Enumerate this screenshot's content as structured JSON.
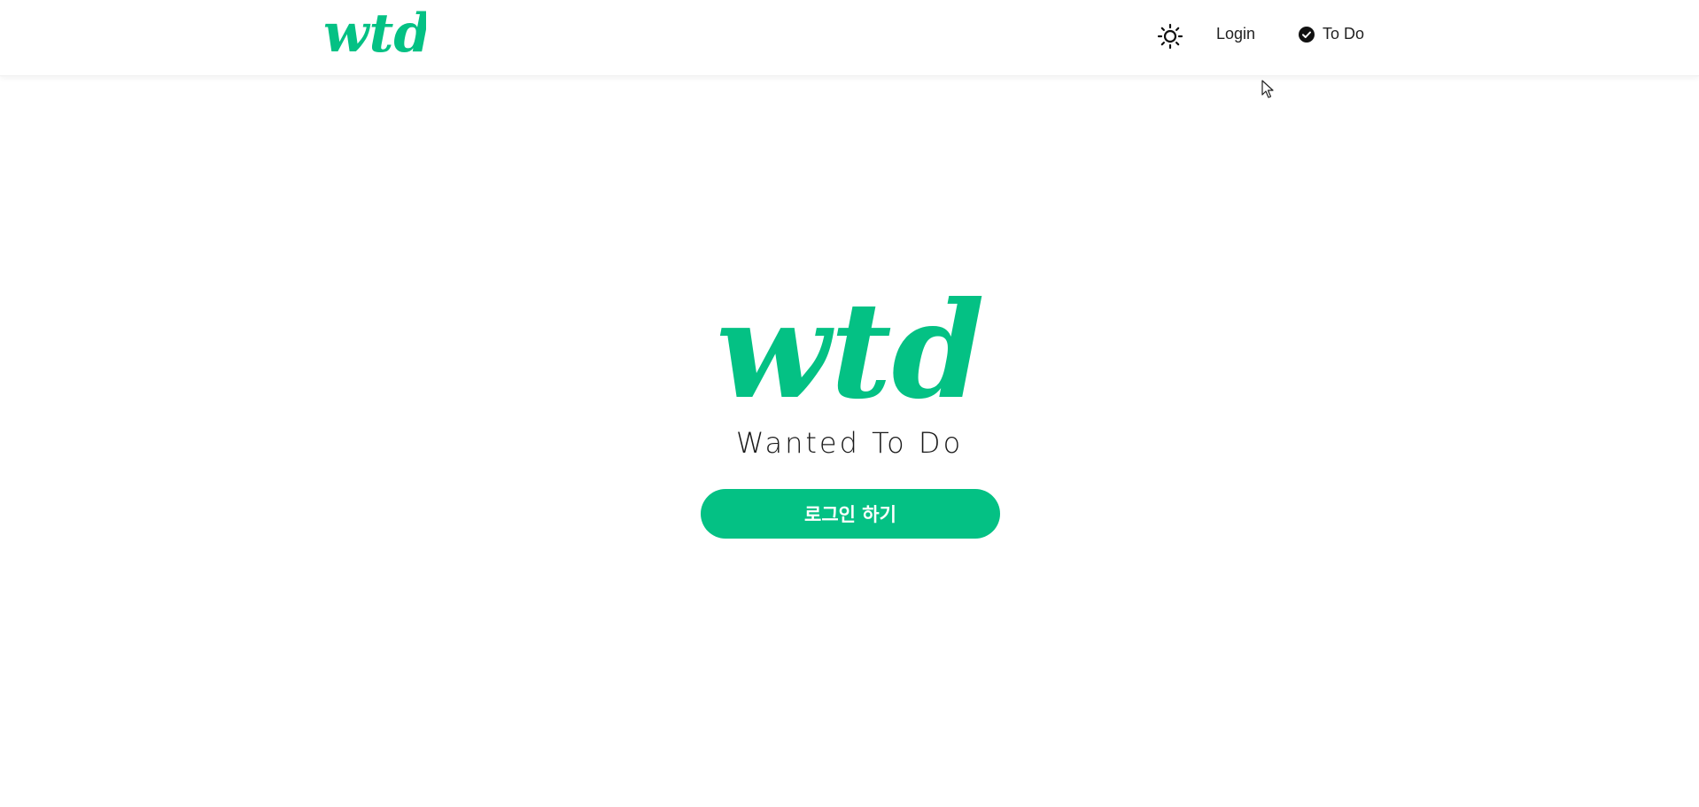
{
  "colors": {
    "brand": "#04c184",
    "text": "#1a1a1a",
    "background": "#ffffff"
  },
  "header": {
    "logo_text": "wtd",
    "theme_icon": "sun-icon",
    "login_label": "Login",
    "todo_icon": "check-circle-icon",
    "todo_label": "To Do"
  },
  "main": {
    "logo_text": "wtd",
    "tagline": "Wanted To Do",
    "login_button_label": "로그인 하기"
  }
}
